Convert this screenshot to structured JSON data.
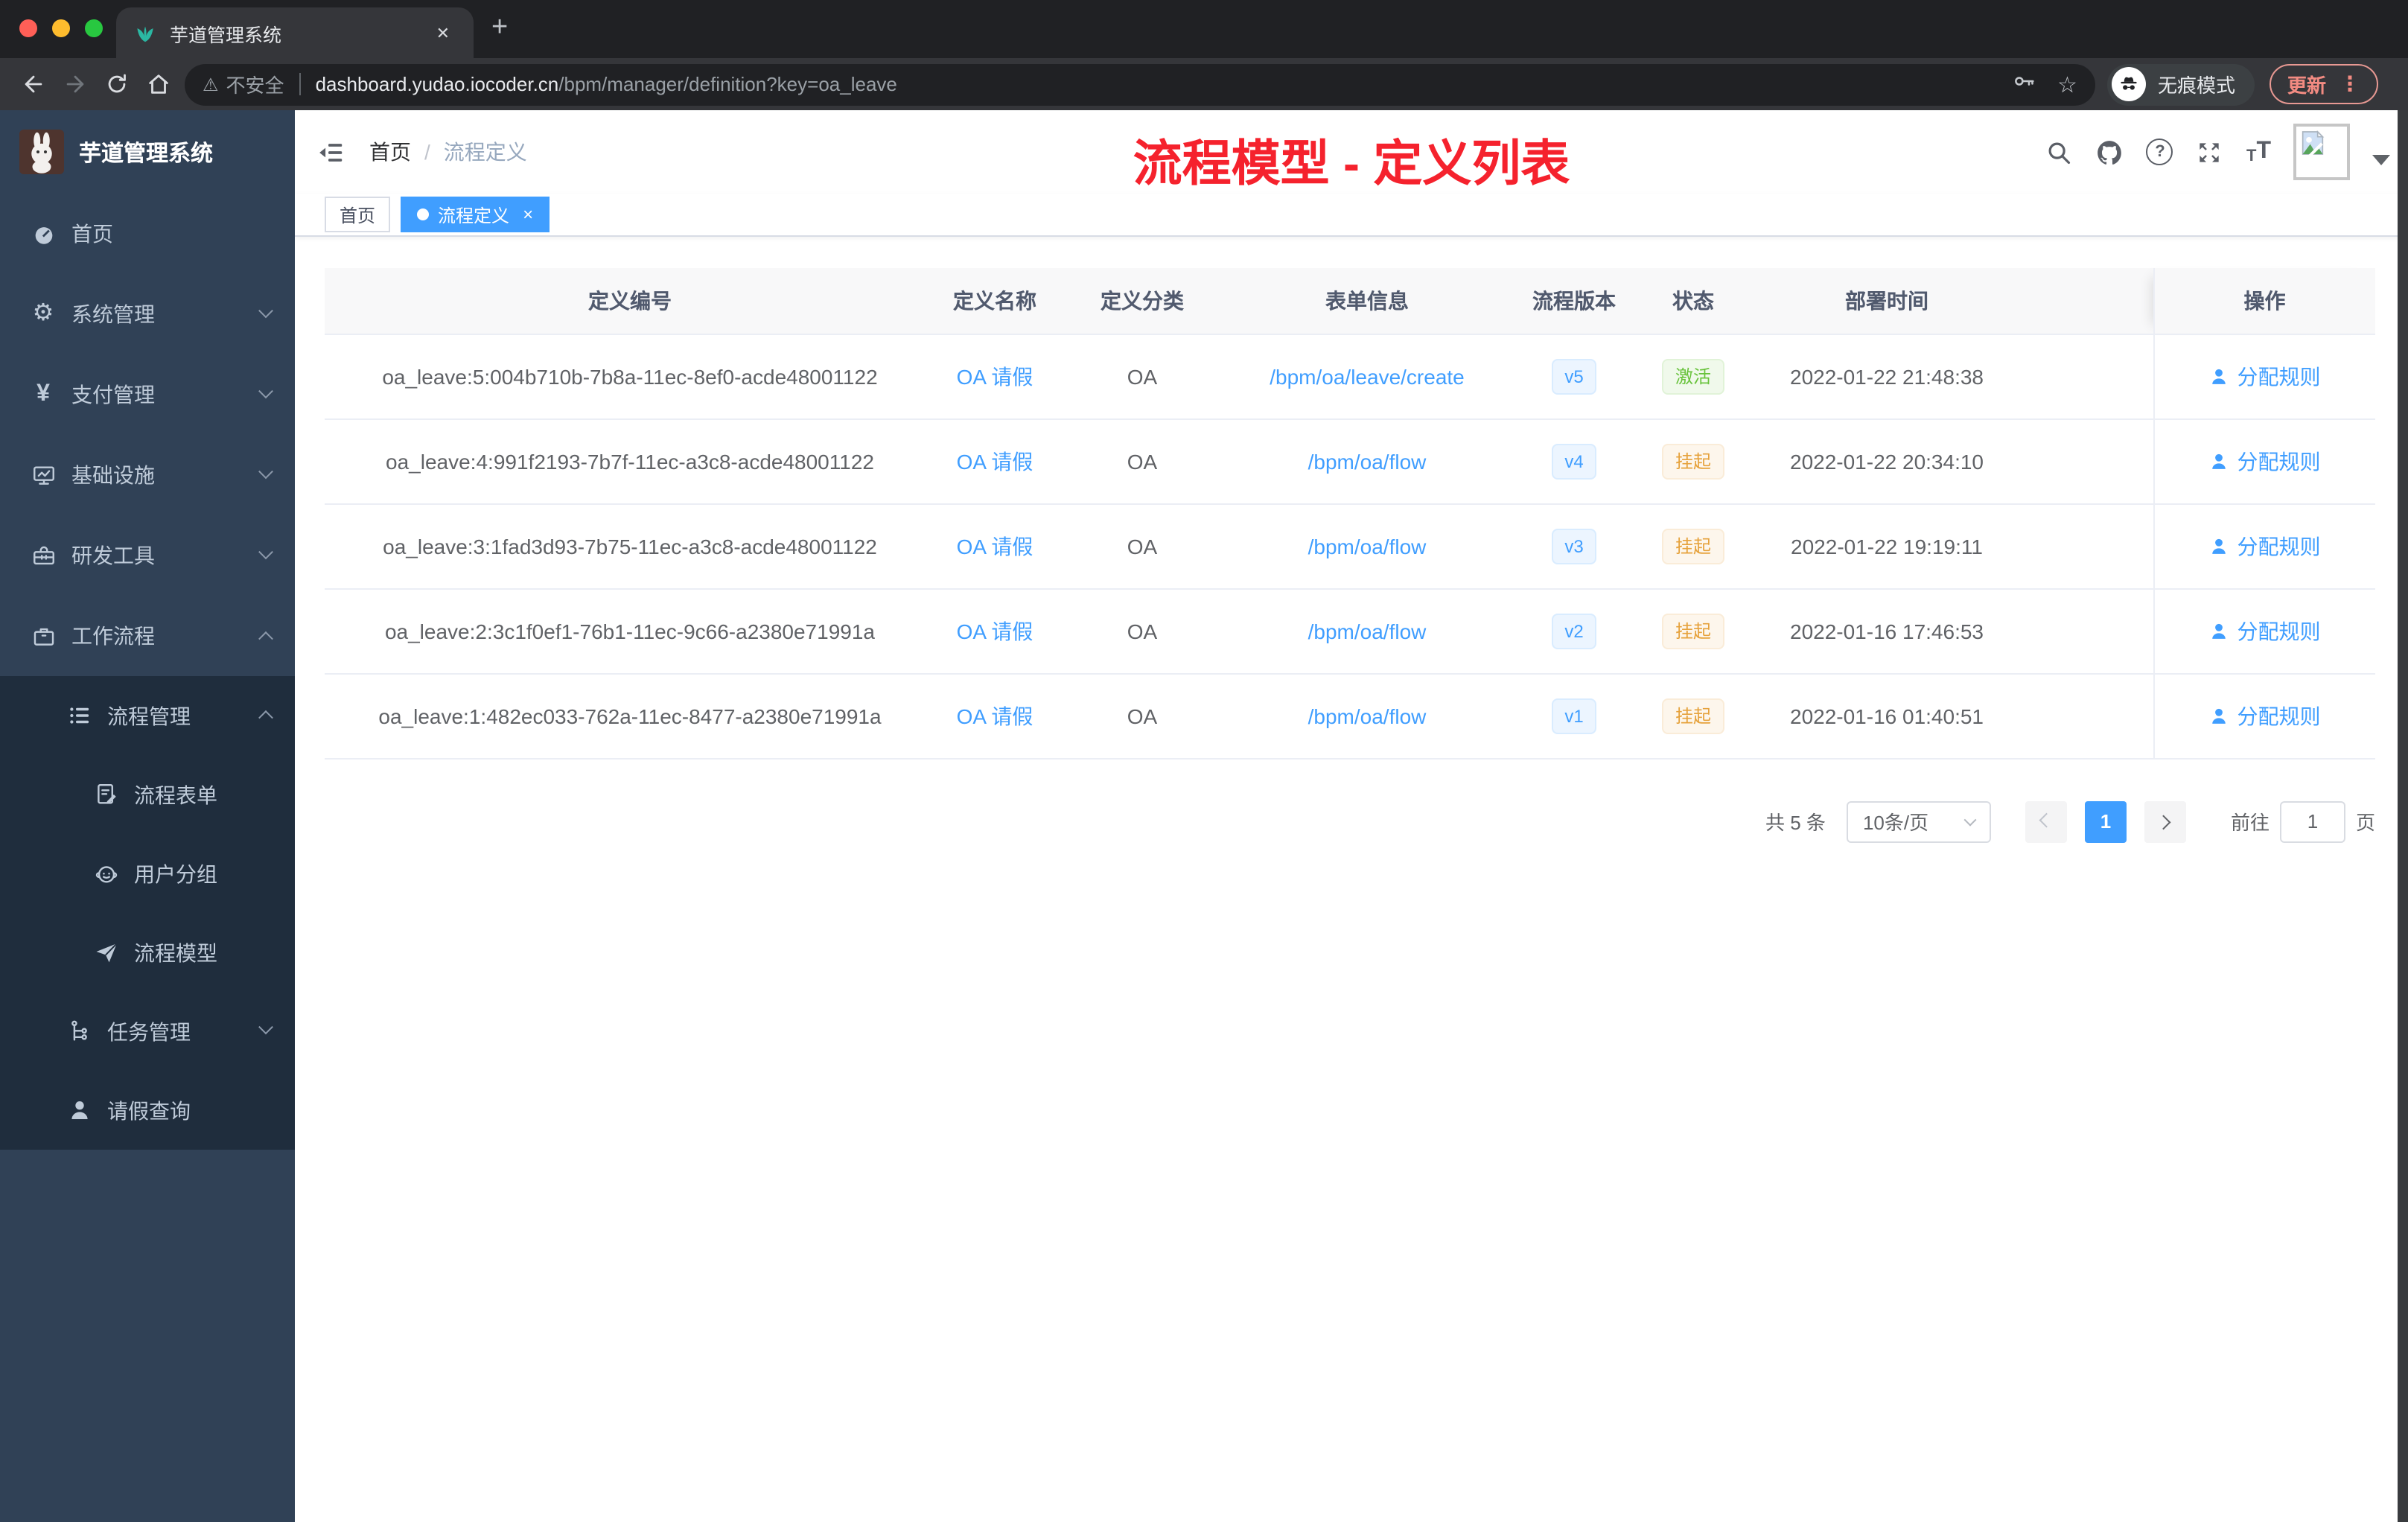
{
  "colors": {
    "accent_blue": "#409eff",
    "success_green": "#67c23a",
    "warning_orange": "#e6a23c",
    "annotation_red": "#f5222d",
    "sidebar_bg": "#304156",
    "sidebar_submenu_bg": "#1f2d3d",
    "sidebar_text": "#bfcbd9",
    "chrome_frame": "#202124",
    "chrome_toolbar": "#35363a",
    "table_header_bg": "#f8f8f9",
    "update_red": "#f28b82",
    "favicon_teal": "#2bb8a3"
  },
  "icons": {
    "close": "✕",
    "new_tab": "+",
    "more": "⋮",
    "star": "☆",
    "warning": "⚠",
    "gear": "⚙",
    "yen": "¥",
    "help": "?",
    "tag_close": "×"
  },
  "browser": {
    "tab": {
      "title": "芋道管理系统"
    },
    "toolbar": {
      "security": "不安全",
      "url_host": "dashboard.yudao.iocoder.cn",
      "url_path": "/bpm/manager/definition?key=oa_leave",
      "incognito": "无痕模式",
      "update": "更新"
    }
  },
  "app": {
    "sidebar": {
      "title": "芋道管理系统",
      "items": [
        {
          "label": "首页"
        },
        {
          "label": "系统管理"
        },
        {
          "label": "支付管理"
        },
        {
          "label": "基础设施"
        },
        {
          "label": "研发工具"
        },
        {
          "label": "工作流程"
        },
        {
          "label": "流程管理"
        },
        {
          "label": "流程表单"
        },
        {
          "label": "用户分组"
        },
        {
          "label": "流程模型"
        },
        {
          "label": "任务管理"
        },
        {
          "label": "请假查询"
        }
      ]
    },
    "header": {
      "breadcrumb_home": "首页",
      "breadcrumb_sep": "/",
      "breadcrumb_current": "流程定义",
      "annotation": "流程模型 - 定义列表"
    },
    "tags": [
      {
        "label": "首页"
      },
      {
        "label": "流程定义"
      }
    ],
    "table": {
      "columns": [
        "定义编号",
        "定义名称",
        "定义分类",
        "表单信息",
        "流程版本",
        "状态",
        "部署时间",
        "操作"
      ],
      "rows": [
        {
          "id": "oa_leave:5:004b710b-7b8a-11ec-8ef0-acde48001122",
          "name": "OA 请假",
          "category": "OA",
          "form": "/bpm/oa/leave/create",
          "version": "v5",
          "status": "激活",
          "time": "2022-01-22 21:48:38",
          "action": "分配规则"
        },
        {
          "id": "oa_leave:4:991f2193-7b7f-11ec-a3c8-acde48001122",
          "name": "OA 请假",
          "category": "OA",
          "form": "/bpm/oa/flow",
          "version": "v4",
          "status": "挂起",
          "time": "2022-01-22 20:34:10",
          "action": "分配规则"
        },
        {
          "id": "oa_leave:3:1fad3d93-7b75-11ec-a3c8-acde48001122",
          "name": "OA 请假",
          "category": "OA",
          "form": "/bpm/oa/flow",
          "version": "v3",
          "status": "挂起",
          "time": "2022-01-22 19:19:11",
          "action": "分配规则"
        },
        {
          "id": "oa_leave:2:3c1f0ef1-76b1-11ec-9c66-a2380e71991a",
          "name": "OA 请假",
          "category": "OA",
          "form": "/bpm/oa/flow",
          "version": "v2",
          "status": "挂起",
          "time": "2022-01-16 17:46:53",
          "action": "分配规则"
        },
        {
          "id": "oa_leave:1:482ec033-762a-11ec-8477-a2380e71991a",
          "name": "OA 请假",
          "category": "OA",
          "form": "/bpm/oa/flow",
          "version": "v1",
          "status": "挂起",
          "time": "2022-01-16 01:40:51",
          "action": "分配规则"
        }
      ]
    },
    "pagination": {
      "total": "共 5 条",
      "page_size": "10条/页",
      "current": "1",
      "goto": "前往",
      "goto_value": "1",
      "page_unit": "页"
    }
  }
}
